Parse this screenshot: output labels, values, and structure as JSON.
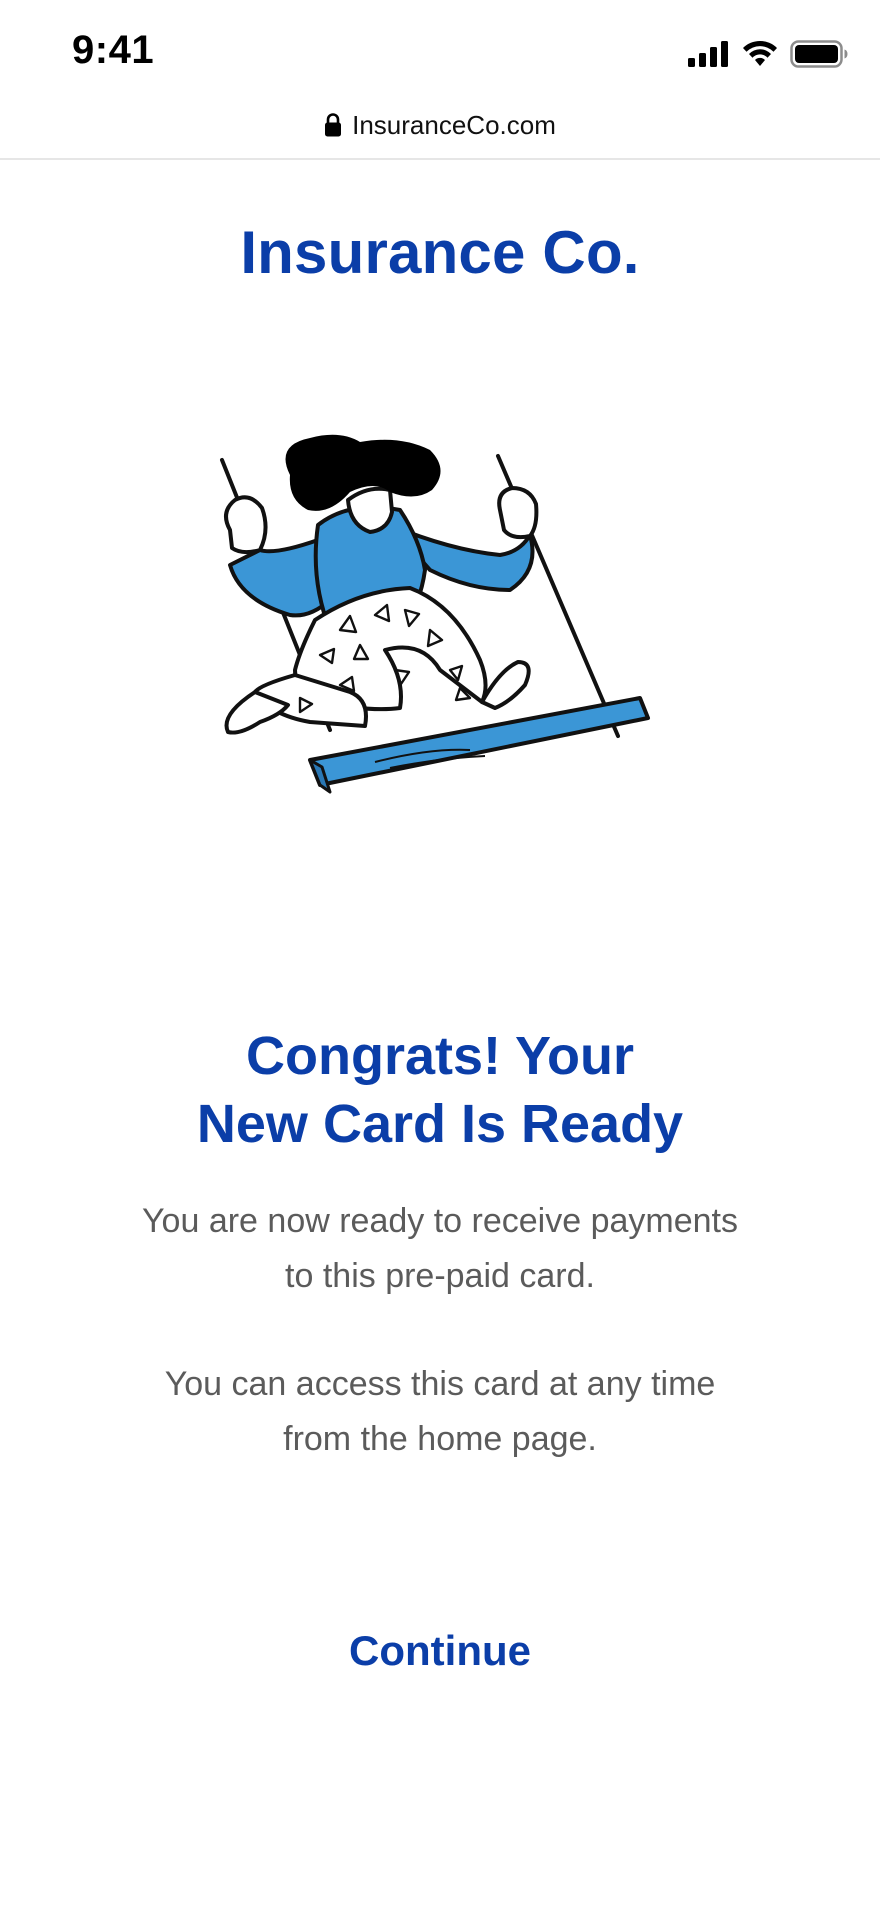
{
  "status_bar": {
    "time": "9:41",
    "signal_icon": "cellular-signal-icon",
    "wifi_icon": "wifi-icon",
    "battery_icon": "battery-icon"
  },
  "browser": {
    "lock_icon": "lock-icon",
    "url": "InsuranceCo.com"
  },
  "brand": {
    "name": "Insurance Co.",
    "color": "#0b3ea8"
  },
  "illustration": {
    "icon": "woman-on-swing-illustration",
    "accent_color": "#3b96d6"
  },
  "headline": {
    "line1": "Congrats! Your",
    "line2": "New Card Is Ready"
  },
  "body": {
    "para1_line1": "You are now ready to receive payments",
    "para1_line2": "to this pre-paid card.",
    "para2_line1": "You can access this card at any time",
    "para2_line2": "from the home page."
  },
  "actions": {
    "continue_label": "Continue"
  }
}
